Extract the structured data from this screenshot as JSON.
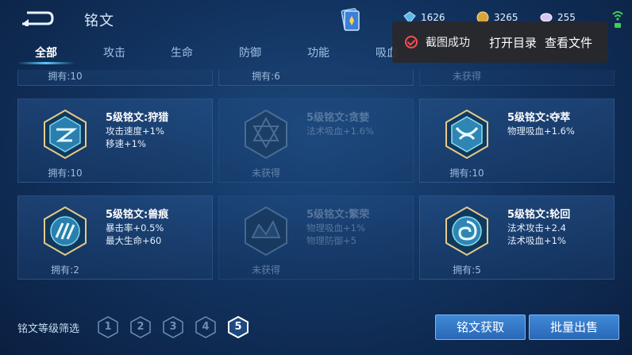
{
  "header": {
    "title": "铭文",
    "currency_gem": "1626",
    "currency_gold": "3265",
    "currency_pearl": "255"
  },
  "tabs": [
    {
      "label": "全部",
      "active": true
    },
    {
      "label": "攻击",
      "active": false
    },
    {
      "label": "生命",
      "active": false
    },
    {
      "label": "防御",
      "active": false
    },
    {
      "label": "功能",
      "active": false
    },
    {
      "label": "吸血",
      "active": false
    }
  ],
  "toast": {
    "message": "截图成功",
    "open_folder": "打开目录",
    "view_file": "查看文件"
  },
  "partial_row": {
    "left_owned": "拥有:10",
    "mid_owned": "拥有:6",
    "right_owned": "未获得"
  },
  "cards": [
    {
      "name": "5级铭文:狩猎",
      "stat1": "攻击速度+1%",
      "stat2": "移速+1%",
      "owned": "拥有:10",
      "locked": false,
      "icon": "hunt-rune-icon",
      "color": "#7fd6f0"
    },
    {
      "name": "5级铭文:贪婪",
      "stat1": "法术吸血+1.6%",
      "stat2": "",
      "owned": "未获得",
      "locked": true,
      "icon": "greed-rune-icon",
      "color": "#6f8fae"
    },
    {
      "name": "5级铭文:夺萃",
      "stat1": "物理吸血+1.6%",
      "stat2": "",
      "owned": "拥有:10",
      "locked": false,
      "icon": "plunder-rune-icon",
      "color": "#8fe0f5"
    },
    {
      "name": "5级铭文:兽痕",
      "stat1": "暴击率+0.5%",
      "stat2": "最大生命+60",
      "owned": "拥有:2",
      "locked": false,
      "icon": "beast-mark-rune-icon",
      "color": "#7fd6f0"
    },
    {
      "name": "5级铭文:繁荣",
      "stat1": "物理吸血+1%",
      "stat2": "物理防御+5",
      "owned": "未获得",
      "locked": true,
      "icon": "prosper-rune-icon",
      "color": "#6f8fae"
    },
    {
      "name": "5级铭文:轮回",
      "stat1": "法术攻击+2.4",
      "stat2": "法术吸血+1%",
      "owned": "拥有:5",
      "locked": false,
      "icon": "reincarnation-rune-icon",
      "color": "#8fe0f5"
    }
  ],
  "footer": {
    "filter_label": "铭文等级筛选",
    "levels": [
      "1",
      "2",
      "3",
      "4",
      "5"
    ],
    "active_level": "5",
    "obtain_button": "铭文获取",
    "sell_button": "批量出售"
  },
  "colors": {
    "accent": "#5ac8ff",
    "button": "#2f73c4",
    "error": "#ff4d4f"
  }
}
